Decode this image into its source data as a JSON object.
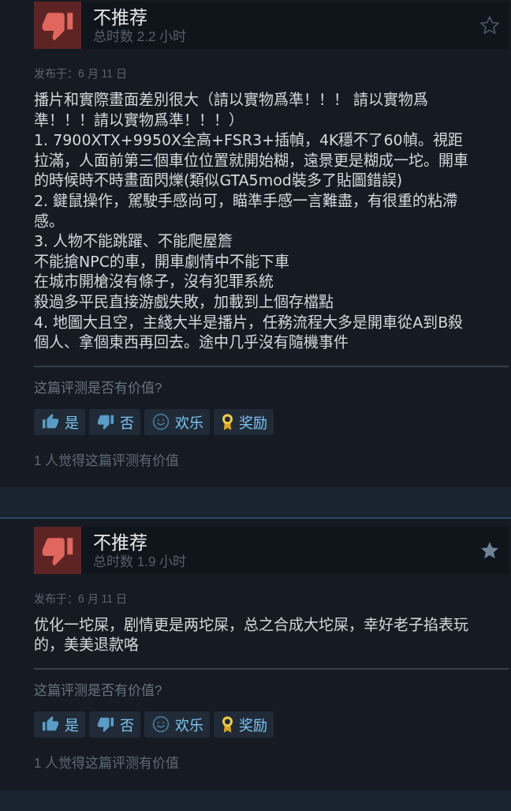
{
  "reviews": [
    {
      "recommended": false,
      "verdict": "不推荐",
      "playtime": "总时数 2.2 小时",
      "starred": false,
      "posted": "发布于：6 月 11 日",
      "body": [
        "播片和實際畫面差別很大（請以實物爲準！！！ 請以實物爲準！！！請以實物爲準！！！）",
        "1. 7900XTX+9950X全高+FSR3+插幀，4K穩不了60幀。視距拉滿，人面前第三個車位位置就開始糊，遠景更是糊成一坨。開車的時候時不時畫面閃爍(類似GTA5mod裝多了貼圖錯誤)",
        "2. 鍵鼠操作，駕駛手感尚可，瞄準手感一言難盡，有很重的粘滯感。",
        "3. 人物不能跳躍、不能爬屋簷",
        "不能搶NPC的車，開車劇情中不能下車",
        "在城市開槍沒有條子，沒有犯罪系統",
        "殺過多平民直接游戲失敗，加載到上個存檔點",
        "4. 地圖大且空，主綫大半是播片，任務流程大多是開車從A到B殺個人、拿個東西再回去。途中几乎沒有隨機事件"
      ],
      "helpful_prompt": "这篇评测是否有价值?",
      "vote_buttons": [
        {
          "kind": "yes",
          "label": "是"
        },
        {
          "kind": "no",
          "label": "否"
        },
        {
          "kind": "funny",
          "label": "欢乐"
        },
        {
          "kind": "award",
          "label": "奖励"
        }
      ],
      "helpful_count": "1 人觉得这篇评测有价值"
    },
    {
      "recommended": false,
      "verdict": "不推荐",
      "playtime": "总时数 1.9 小时",
      "starred": true,
      "posted": "发布于：6 月 11 日",
      "body": [
        "优化一坨屎，剧情更是两坨屎，总之合成大坨屎，幸好老子掐表玩的，美美退款咯"
      ],
      "helpful_prompt": "这篇评测是否有价值?",
      "vote_buttons": [
        {
          "kind": "yes",
          "label": "是"
        },
        {
          "kind": "no",
          "label": "否"
        },
        {
          "kind": "funny",
          "label": "欢乐"
        },
        {
          "kind": "award",
          "label": "奖励"
        }
      ],
      "helpful_count": "1 人觉得这篇评测有价值"
    }
  ]
}
